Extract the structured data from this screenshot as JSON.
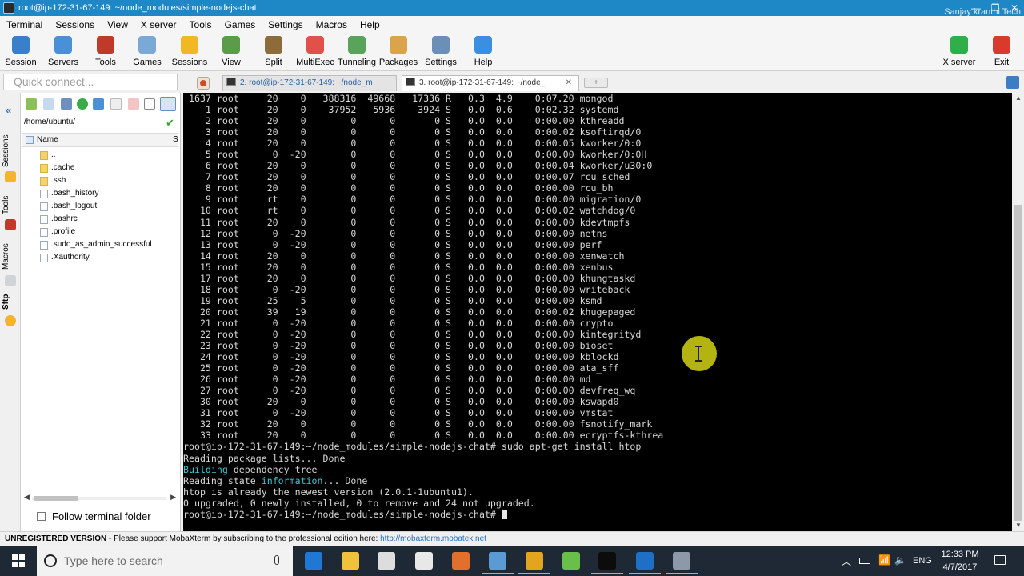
{
  "window": {
    "title": "root@ip-172-31-67-149: ~/node_modules/simple-nodejs-chat",
    "watermark": "Sanjay kranthi Tech",
    "controls": [
      "—",
      "❐",
      "✕"
    ]
  },
  "menu": [
    "Terminal",
    "Sessions",
    "View",
    "X server",
    "Tools",
    "Games",
    "Settings",
    "Macros",
    "Help"
  ],
  "toolbar": {
    "left": [
      {
        "label": "Session",
        "icon": "session-icon",
        "color": "#3a7fc9"
      },
      {
        "label": "Servers",
        "icon": "servers-icon",
        "color": "#4a90d9"
      },
      {
        "label": "Tools",
        "icon": "tools-icon",
        "color": "#c0392b"
      },
      {
        "label": "Games",
        "icon": "games-icon",
        "color": "#7aa9d6"
      },
      {
        "label": "Sessions",
        "icon": "star-icon",
        "color": "#f2b824"
      },
      {
        "label": "View",
        "icon": "view-icon",
        "color": "#5b9b4a"
      },
      {
        "label": "Split",
        "icon": "split-icon",
        "color": "#8e6b3a"
      },
      {
        "label": "MultiExec",
        "icon": "multiexec-icon",
        "color": "#e2504a"
      },
      {
        "label": "Tunneling",
        "icon": "tunneling-icon",
        "color": "#5aa35a"
      },
      {
        "label": "Packages",
        "icon": "packages-icon",
        "color": "#d9a44c"
      },
      {
        "label": "Settings",
        "icon": "settings-icon",
        "color": "#6b8fb5"
      },
      {
        "label": "Help",
        "icon": "help-icon",
        "color": "#3b8fe0"
      }
    ],
    "right": [
      {
        "label": "X server",
        "icon": "xserver-icon",
        "color": "#2fae4a"
      },
      {
        "label": "Exit",
        "icon": "exit-icon",
        "color": "#d93a2b"
      }
    ]
  },
  "quick_connect": {
    "placeholder": "Quick connect..."
  },
  "tabs": [
    {
      "label": "2. root@ip-172-31-67-149: ~/node_m",
      "active": false
    },
    {
      "label": "3. root@ip-172-31-67-149: ~/node_",
      "active": true
    }
  ],
  "side_tabs": [
    "Sessions",
    "Tools",
    "Macros",
    "Sftp"
  ],
  "sftp": {
    "path": "/home/ubuntu/",
    "col_name": "Name",
    "col_size": "S",
    "files": [
      {
        "name": "..",
        "type": "dir"
      },
      {
        "name": ".cache",
        "type": "dir"
      },
      {
        "name": ".ssh",
        "type": "dir"
      },
      {
        "name": ".bash_history",
        "type": "file"
      },
      {
        "name": ".bash_logout",
        "type": "file"
      },
      {
        "name": ".bashrc",
        "type": "file"
      },
      {
        "name": ".profile",
        "type": "file"
      },
      {
        "name": ".sudo_as_admin_successful",
        "type": "file"
      },
      {
        "name": ".Xauthority",
        "type": "file"
      }
    ],
    "follow_label": "Follow terminal folder"
  },
  "terminal": {
    "processes": [
      [
        "1637",
        "root",
        "20",
        "0",
        "388316",
        "49668",
        "17336",
        "R",
        "0.3",
        "4.9",
        "0:07.20",
        "mongod"
      ],
      [
        "1",
        "root",
        "20",
        "0",
        "37952",
        "5936",
        "3924",
        "S",
        "0.0",
        "0.6",
        "0:02.32",
        "systemd"
      ],
      [
        "2",
        "root",
        "20",
        "0",
        "0",
        "0",
        "0",
        "S",
        "0.0",
        "0.0",
        "0:00.00",
        "kthreadd"
      ],
      [
        "3",
        "root",
        "20",
        "0",
        "0",
        "0",
        "0",
        "S",
        "0.0",
        "0.0",
        "0:00.02",
        "ksoftirqd/0"
      ],
      [
        "4",
        "root",
        "20",
        "0",
        "0",
        "0",
        "0",
        "S",
        "0.0",
        "0.0",
        "0:00.05",
        "kworker/0:0"
      ],
      [
        "5",
        "root",
        "0",
        "-20",
        "0",
        "0",
        "0",
        "S",
        "0.0",
        "0.0",
        "0:00.00",
        "kworker/0:0H"
      ],
      [
        "6",
        "root",
        "20",
        "0",
        "0",
        "0",
        "0",
        "S",
        "0.0",
        "0.0",
        "0:00.04",
        "kworker/u30:0"
      ],
      [
        "7",
        "root",
        "20",
        "0",
        "0",
        "0",
        "0",
        "S",
        "0.0",
        "0.0",
        "0:00.07",
        "rcu_sched"
      ],
      [
        "8",
        "root",
        "20",
        "0",
        "0",
        "0",
        "0",
        "S",
        "0.0",
        "0.0",
        "0:00.00",
        "rcu_bh"
      ],
      [
        "9",
        "root",
        "rt",
        "0",
        "0",
        "0",
        "0",
        "S",
        "0.0",
        "0.0",
        "0:00.00",
        "migration/0"
      ],
      [
        "10",
        "root",
        "rt",
        "0",
        "0",
        "0",
        "0",
        "S",
        "0.0",
        "0.0",
        "0:00.02",
        "watchdog/0"
      ],
      [
        "11",
        "root",
        "20",
        "0",
        "0",
        "0",
        "0",
        "S",
        "0.0",
        "0.0",
        "0:00.00",
        "kdevtmpfs"
      ],
      [
        "12",
        "root",
        "0",
        "-20",
        "0",
        "0",
        "0",
        "S",
        "0.0",
        "0.0",
        "0:00.00",
        "netns"
      ],
      [
        "13",
        "root",
        "0",
        "-20",
        "0",
        "0",
        "0",
        "S",
        "0.0",
        "0.0",
        "0:00.00",
        "perf"
      ],
      [
        "14",
        "root",
        "20",
        "0",
        "0",
        "0",
        "0",
        "S",
        "0.0",
        "0.0",
        "0:00.00",
        "xenwatch"
      ],
      [
        "15",
        "root",
        "20",
        "0",
        "0",
        "0",
        "0",
        "S",
        "0.0",
        "0.0",
        "0:00.00",
        "xenbus"
      ],
      [
        "17",
        "root",
        "20",
        "0",
        "0",
        "0",
        "0",
        "S",
        "0.0",
        "0.0",
        "0:00.00",
        "khungtaskd"
      ],
      [
        "18",
        "root",
        "0",
        "-20",
        "0",
        "0",
        "0",
        "S",
        "0.0",
        "0.0",
        "0:00.00",
        "writeback"
      ],
      [
        "19",
        "root",
        "25",
        "5",
        "0",
        "0",
        "0",
        "S",
        "0.0",
        "0.0",
        "0:00.00",
        "ksmd"
      ],
      [
        "20",
        "root",
        "39",
        "19",
        "0",
        "0",
        "0",
        "S",
        "0.0",
        "0.0",
        "0:00.02",
        "khugepaged"
      ],
      [
        "21",
        "root",
        "0",
        "-20",
        "0",
        "0",
        "0",
        "S",
        "0.0",
        "0.0",
        "0:00.00",
        "crypto"
      ],
      [
        "22",
        "root",
        "0",
        "-20",
        "0",
        "0",
        "0",
        "S",
        "0.0",
        "0.0",
        "0:00.00",
        "kintegrityd"
      ],
      [
        "23",
        "root",
        "0",
        "-20",
        "0",
        "0",
        "0",
        "S",
        "0.0",
        "0.0",
        "0:00.00",
        "bioset"
      ],
      [
        "24",
        "root",
        "0",
        "-20",
        "0",
        "0",
        "0",
        "S",
        "0.0",
        "0.0",
        "0:00.00",
        "kblockd"
      ],
      [
        "25",
        "root",
        "0",
        "-20",
        "0",
        "0",
        "0",
        "S",
        "0.0",
        "0.0",
        "0:00.00",
        "ata_sff"
      ],
      [
        "26",
        "root",
        "0",
        "-20",
        "0",
        "0",
        "0",
        "S",
        "0.0",
        "0.0",
        "0:00.00",
        "md"
      ],
      [
        "27",
        "root",
        "0",
        "-20",
        "0",
        "0",
        "0",
        "S",
        "0.0",
        "0.0",
        "0:00.00",
        "devfreq_wq"
      ],
      [
        "30",
        "root",
        "20",
        "0",
        "0",
        "0",
        "0",
        "S",
        "0.0",
        "0.0",
        "0:00.00",
        "kswapd0"
      ],
      [
        "31",
        "root",
        "0",
        "-20",
        "0",
        "0",
        "0",
        "S",
        "0.0",
        "0.0",
        "0:00.00",
        "vmstat"
      ],
      [
        "32",
        "root",
        "20",
        "0",
        "0",
        "0",
        "0",
        "S",
        "0.0",
        "0.0",
        "0:00.00",
        "fsnotify_mark"
      ],
      [
        "33",
        "root",
        "20",
        "0",
        "0",
        "0",
        "0",
        "S",
        "0.0",
        "0.0",
        "0:00.00",
        "ecryptfs-kthrea"
      ]
    ],
    "output": [
      {
        "text": "root@ip-172-31-67-149:~/node_modules/simple-nodejs-chat# sudo apt-get install htop"
      },
      {
        "text": "Reading package lists... Done"
      },
      {
        "pre": "",
        "cyan": "Building",
        "post": " dependency tree"
      },
      {
        "pre": "Reading state ",
        "cyan": "information",
        "post": "... Done"
      },
      {
        "text": "htop is already the newest version (2.0.1-1ubuntu1)."
      },
      {
        "text": "0 upgraded, 0 newly installed, 0 to remove and 24 not upgraded."
      }
    ],
    "prompt": "root@ip-172-31-67-149:~/node_modules/simple-nodejs-chat# "
  },
  "statusbar": {
    "bold": "UNREGISTERED VERSION",
    "text": "  -  Please support MobaXterm by subscribing to the professional edition here:  ",
    "link": "http://mobaxterm.mobatek.net"
  },
  "taskbar": {
    "search_placeholder": "Type here to search",
    "apps": [
      {
        "icon": "edge-icon",
        "color": "#1e78d4"
      },
      {
        "icon": "file-explorer-icon",
        "color": "#f0c23c"
      },
      {
        "icon": "store-icon",
        "color": "#dddddd"
      },
      {
        "icon": "mail-icon",
        "color": "#e8e8e8"
      },
      {
        "icon": "paint-icon",
        "color": "#e0702c"
      },
      {
        "icon": "winscp-icon",
        "color": "#5b9bd5"
      },
      {
        "icon": "chrome-icon",
        "color": "#e2a51d"
      },
      {
        "icon": "notepad-icon",
        "color": "#6abf4b"
      },
      {
        "icon": "cmd-icon",
        "color": "#0c0c0c"
      },
      {
        "icon": "outlook-icon",
        "color": "#1f6fc7"
      },
      {
        "icon": "mobaxterm-icon",
        "color": "#8c99a8"
      }
    ],
    "language": "ENG",
    "time": "12:33 PM",
    "date": "4/7/2017"
  }
}
